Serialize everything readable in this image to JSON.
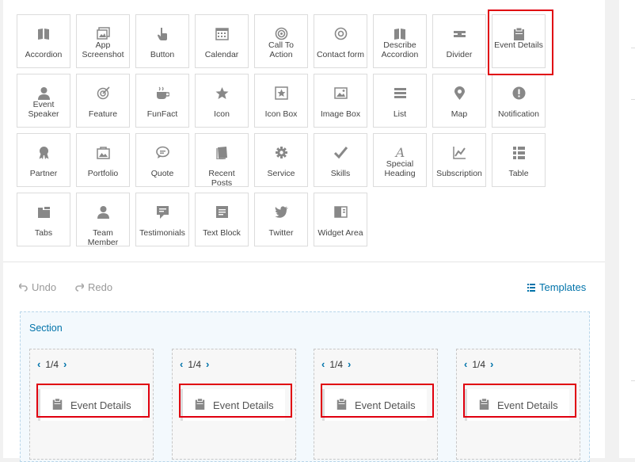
{
  "widgets": [
    {
      "label": "Accordion",
      "icon": "book-icon"
    },
    {
      "label": "App Screenshot",
      "icon": "images-icon"
    },
    {
      "label": "Button",
      "icon": "hand-pointer-icon"
    },
    {
      "label": "Calendar",
      "icon": "calendar-icon"
    },
    {
      "label": "Call To Action",
      "icon": "target-icon"
    },
    {
      "label": "Contact form",
      "icon": "at-icon"
    },
    {
      "label": "Describe Accordion",
      "icon": "book-icon"
    },
    {
      "label": "Divider",
      "icon": "divider-icon"
    },
    {
      "label": "Event Details",
      "icon": "clipboard-icon"
    },
    {
      "label": "Event Speaker",
      "icon": "user-icon"
    },
    {
      "label": "Feature",
      "icon": "bullseye-icon"
    },
    {
      "label": "FunFact",
      "icon": "coffee-icon"
    },
    {
      "label": "Icon",
      "icon": "star-icon"
    },
    {
      "label": "Icon Box",
      "icon": "star-box-icon"
    },
    {
      "label": "Image Box",
      "icon": "image-icon"
    },
    {
      "label": "List",
      "icon": "list-icon"
    },
    {
      "label": "Map",
      "icon": "map-marker-icon"
    },
    {
      "label": "Notification",
      "icon": "exclamation-icon"
    },
    {
      "label": "Partner",
      "icon": "award-icon"
    },
    {
      "label": "Portfolio",
      "icon": "portfolio-icon"
    },
    {
      "label": "Quote",
      "icon": "speech-bubble-icon"
    },
    {
      "label": "Recent Posts",
      "icon": "notebook-icon"
    },
    {
      "label": "Service",
      "icon": "gear-icon"
    },
    {
      "label": "Skills",
      "icon": "check-icon"
    },
    {
      "label": "Special Heading",
      "icon": "script-a-icon"
    },
    {
      "label": "Subscription",
      "icon": "chart-icon"
    },
    {
      "label": "Table",
      "icon": "table-icon"
    },
    {
      "label": "Tabs",
      "icon": "folder-icon"
    },
    {
      "label": "Team Member",
      "icon": "user-icon"
    },
    {
      "label": "Testimonials",
      "icon": "comment-icon"
    },
    {
      "label": "Text Block",
      "icon": "text-block-icon"
    },
    {
      "label": "Twitter",
      "icon": "twitter-icon"
    },
    {
      "label": "Widget Area",
      "icon": "widget-icon"
    }
  ],
  "toolbar": {
    "undo": "Undo",
    "redo": "Redo",
    "templates": "Templates"
  },
  "section": {
    "label": "Section",
    "columns": [
      {
        "size": "1/4",
        "element": "Event Details"
      },
      {
        "size": "1/4",
        "element": "Event Details"
      },
      {
        "size": "1/4",
        "element": "Event Details"
      },
      {
        "size": "1/4",
        "element": "Event Details"
      }
    ]
  },
  "colors": {
    "accent": "#0073aa",
    "highlight": "#e0000f",
    "icon": "#888888"
  }
}
